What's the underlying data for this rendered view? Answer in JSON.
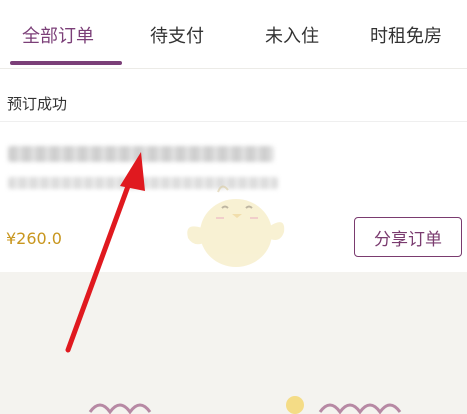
{
  "tabs": [
    {
      "label": "全部订单",
      "active": true
    },
    {
      "label": "待支付",
      "active": false
    },
    {
      "label": "未入住",
      "active": false
    },
    {
      "label": "时租免房",
      "active": false
    }
  ],
  "order": {
    "status": "预订成功",
    "hotel_name": "",
    "hotel_address": "",
    "price": "¥260.0",
    "share_label": "分享订单"
  },
  "colors": {
    "accent": "#7b3f78",
    "price": "#c8961e",
    "annotation_arrow": "#e0191f"
  }
}
